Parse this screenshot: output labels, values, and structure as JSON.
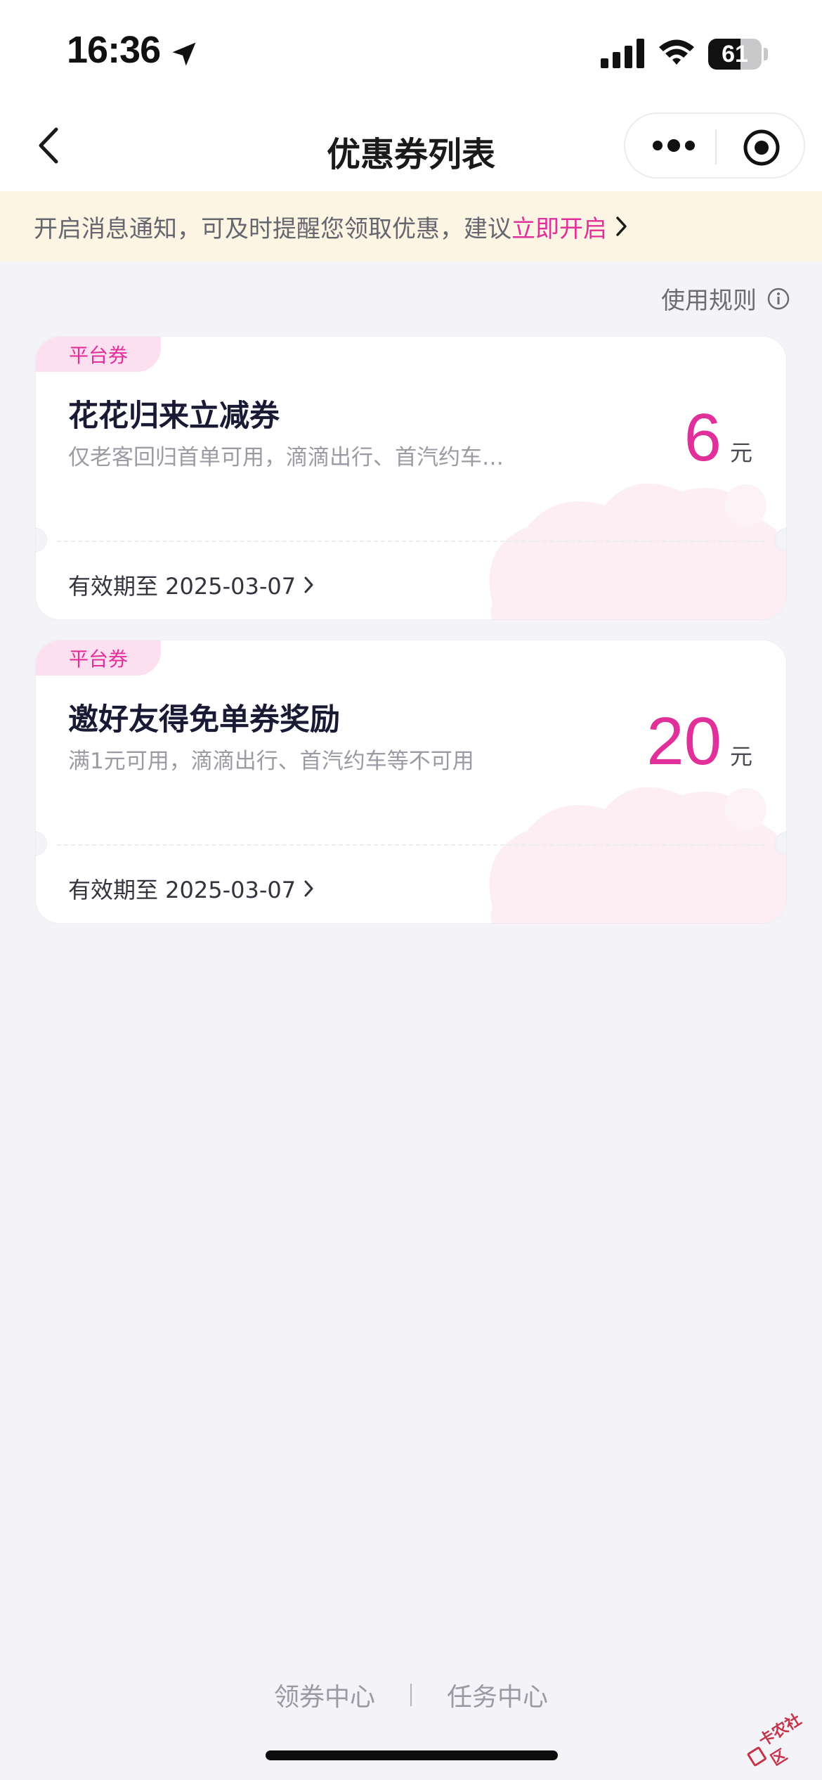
{
  "status_bar": {
    "time": "16:36",
    "battery": "61",
    "battery_level": 0.61
  },
  "nav": {
    "title": "优惠券列表"
  },
  "notice": {
    "text": "开启消息通知，可及时提醒您领取优惠，建议",
    "link": "立即开启"
  },
  "rules": {
    "label": "使用规则"
  },
  "coupons": [
    {
      "tag": "平台券",
      "title": "花花归来立减券",
      "description": "仅老客回归首单可用，滴滴出行、首汽约车…",
      "amount": "6",
      "unit": "元",
      "expiry": "有效期至 2025-03-07"
    },
    {
      "tag": "平台券",
      "title": "邀好友得免单券奖励",
      "description": "满1元可用，滴滴出行、首汽约车等不可用",
      "amount": "20",
      "unit": "元",
      "expiry": "有效期至 2025-03-07"
    }
  ],
  "bottom_links": {
    "left": "领券中心",
    "right": "任务中心"
  },
  "watermark": {
    "text": "卡农社区"
  },
  "colors": {
    "accent": "#e0309a",
    "notice_bg": "#fdf5e4",
    "page_bg": "#f4f4f8"
  }
}
